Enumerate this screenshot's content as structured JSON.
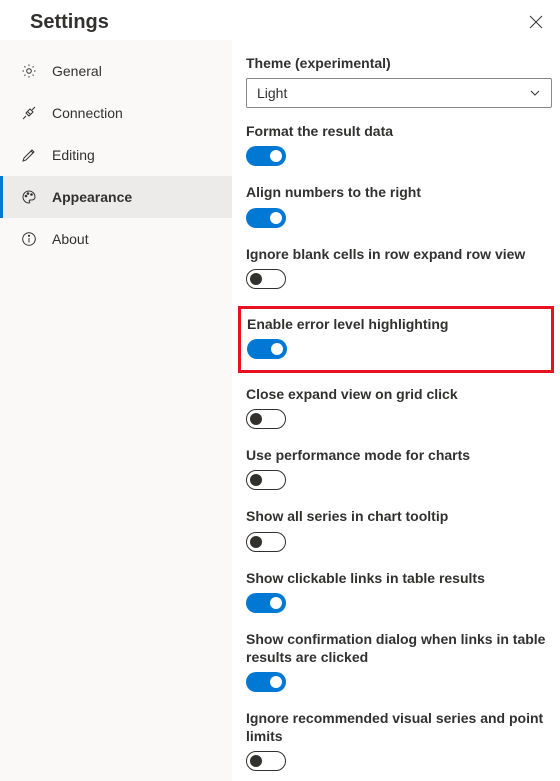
{
  "header": {
    "title": "Settings"
  },
  "sidebar": {
    "items": [
      {
        "label": "General"
      },
      {
        "label": "Connection"
      },
      {
        "label": "Editing"
      },
      {
        "label": "Appearance"
      },
      {
        "label": "About"
      }
    ]
  },
  "content": {
    "theme_label": "Theme (experimental)",
    "theme_value": "Light",
    "settings": [
      {
        "label": "Format the result data",
        "on": true
      },
      {
        "label": "Align numbers to the right",
        "on": true
      },
      {
        "label": "Ignore blank cells in row expand row view",
        "on": false
      },
      {
        "label": "Enable error level highlighting",
        "on": true,
        "highlighted": true
      },
      {
        "label": "Close expand view on grid click",
        "on": false
      },
      {
        "label": "Use performance mode for charts",
        "on": false
      },
      {
        "label": "Show all series in chart tooltip",
        "on": false
      },
      {
        "label": "Show clickable links in table results",
        "on": true
      },
      {
        "label": "Show confirmation dialog when links in table results are clicked",
        "on": true
      },
      {
        "label": "Ignore recommended visual series and point limits",
        "on": false
      }
    ]
  },
  "colors": {
    "accent": "#0078d4",
    "highlight": "#e81123"
  }
}
